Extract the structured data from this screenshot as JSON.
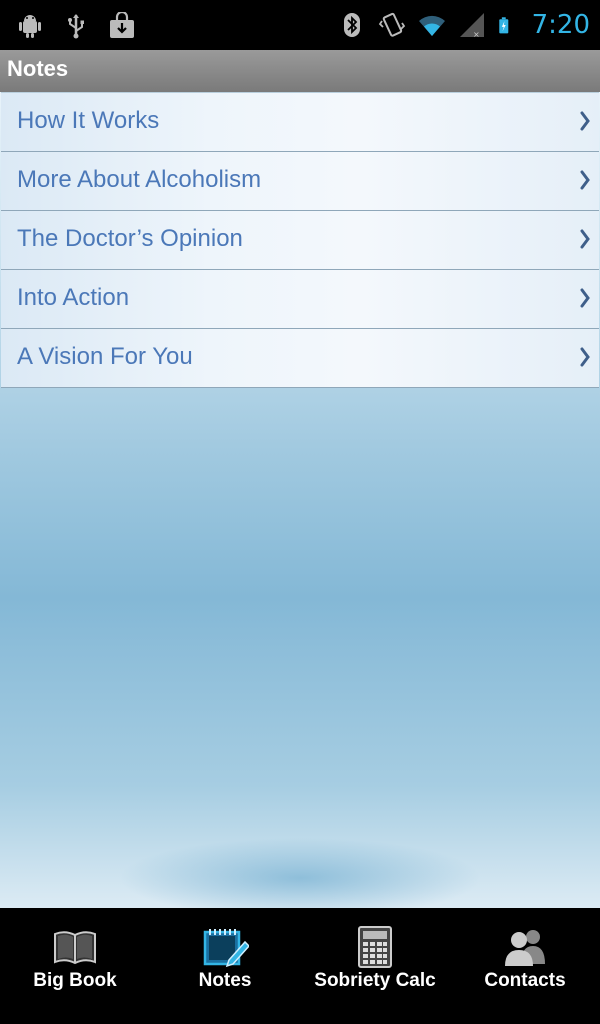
{
  "status_bar": {
    "time": "7:20",
    "icons": [
      "android-debug-icon",
      "usb-icon",
      "download-icon",
      "bluetooth-icon",
      "vibrate-icon",
      "wifi-icon",
      "signal-icon",
      "battery-icon"
    ],
    "time_color": "#33b5e5"
  },
  "title_bar": {
    "title": "Notes"
  },
  "list": {
    "items": [
      {
        "label": "How It Works"
      },
      {
        "label": "More About Alcoholism"
      },
      {
        "label": "The Doctor’s Opinion"
      },
      {
        "label": "Into Action"
      },
      {
        "label": "A Vision For You"
      }
    ],
    "text_color": "#4b78b8"
  },
  "tabs": [
    {
      "label": "Big Book",
      "icon": "book-icon"
    },
    {
      "label": "Notes",
      "icon": "notepad-icon",
      "selected": true
    },
    {
      "label": "Sobriety Calc",
      "icon": "calculator-icon"
    },
    {
      "label": "Contacts",
      "icon": "contacts-icon"
    }
  ]
}
